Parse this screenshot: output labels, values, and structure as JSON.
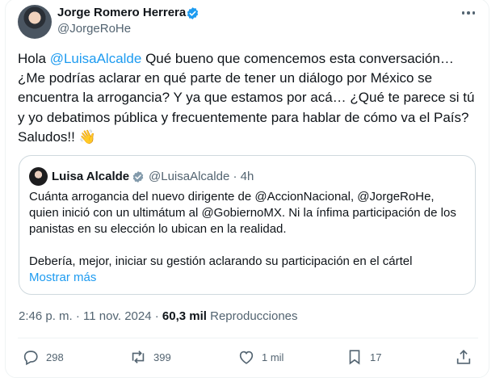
{
  "author": {
    "name": "Jorge Romero Herrera",
    "handle": "@JorgeRoHe"
  },
  "tweet": {
    "greeting": "Hola ",
    "mention": "@LuisaAlcalde",
    "body": " Qué bueno que comencemos esta conversación… ¿Me podrías aclarar en qué parte de tener un diálogo por México se encuentra la arrogancia? Y ya que estamos por acá… ¿Qué te parece si tú y yo debatimos pública y frecuentemente para hablar de cómo va el País?  Saludos!! ",
    "emoji": "👋"
  },
  "quoted": {
    "name": "Luisa Alcalde",
    "handle": "@LuisaAlcalde",
    "time": "4h",
    "paragraph1": "Cuánta arrogancia del nuevo dirigente de @AccionNacional, @JorgeRoHe, quien inició con un ultimátum al @GobiernoMX. Ni la ínfima participación de los panistas en su elección lo ubican en la realidad.",
    "paragraph2": "Debería, mejor, iniciar su gestión aclarando su participación en el cártel",
    "show_more": "Mostrar más"
  },
  "meta": {
    "time": "2:46 p. m.",
    "date": "11 nov. 2024",
    "views_count": "60,3 mil",
    "views_label": "Reproducciones"
  },
  "actions": {
    "replies": "298",
    "reposts": "399",
    "likes": "1 mil",
    "bookmarks": "17"
  },
  "colors": {
    "accent": "#1d9bf0",
    "secondary_text": "#536471",
    "verified": "#1d9bf0"
  }
}
